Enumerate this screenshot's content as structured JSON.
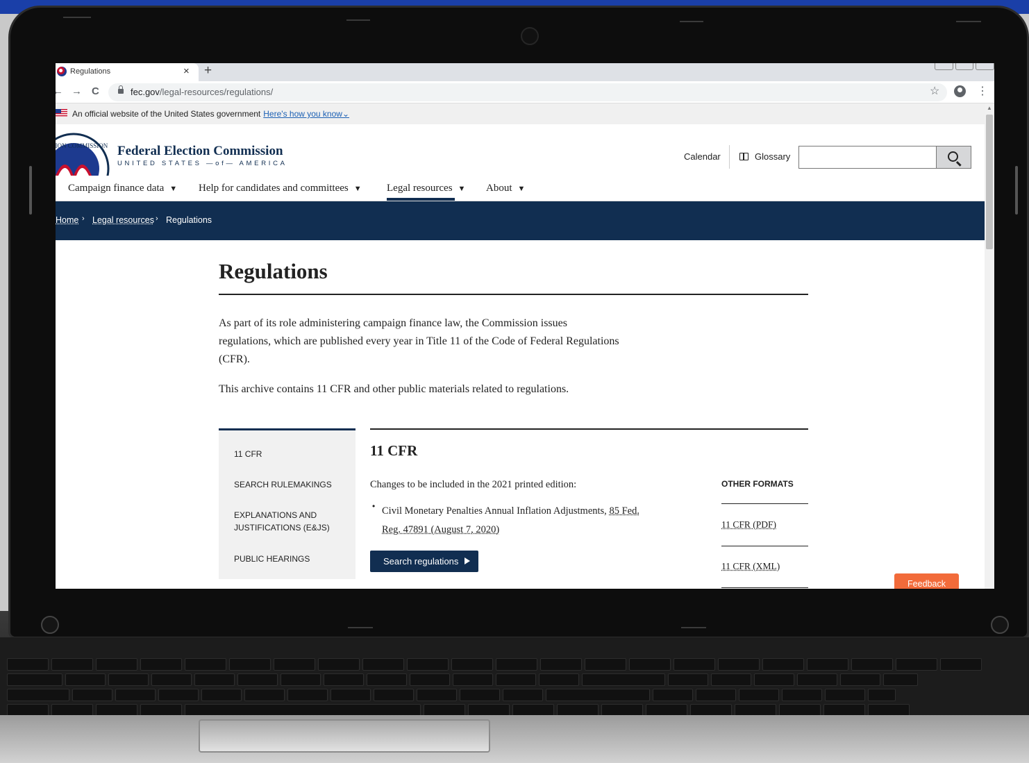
{
  "browser": {
    "tab_title": "Regulations",
    "tab_close": "×",
    "new_tab": "+",
    "back": "←",
    "forward": "→",
    "reload": "C",
    "url_host": "fec.gov",
    "url_path": "/legal-resources/regulations/",
    "bookmark": "☆",
    "menu": "⋮"
  },
  "gov_banner": {
    "text": "An official website of the United States government",
    "link": "Here's how you know",
    "chevron": "⌄"
  },
  "header": {
    "org_name": "Federal Election Commission",
    "org_sub": "UNITED STATES —of— AMERICA",
    "calendar": "Calendar",
    "glossary": "Glossary",
    "search_placeholder": ""
  },
  "nav": {
    "items": [
      {
        "label": "Campaign finance data",
        "caret": "▼"
      },
      {
        "label": "Help for candidates and committees",
        "caret": "▼"
      },
      {
        "label": "Legal resources",
        "caret": "▼"
      },
      {
        "label": "About",
        "caret": "▼"
      }
    ]
  },
  "breadcrumb": {
    "items": [
      "Home",
      "Legal resources",
      "Regulations"
    ],
    "sep": "›"
  },
  "page": {
    "title": "Regulations",
    "intro": "As part of its role administering campaign finance law, the Commission issues regulations, which are published every year in Title 11 of the Code of Federal Regulations (CFR).",
    "archive": "This archive contains 11 CFR and other public materials related to regulations."
  },
  "sidenav": {
    "items": [
      "11 CFR",
      "SEARCH RULEMAKINGS",
      "EXPLANATIONS AND JUSTIFICATIONS (E&JS)",
      "PUBLIC HEARINGS"
    ]
  },
  "section": {
    "title": "11 CFR",
    "changes": "Changes to be included in the 2021 printed edition:",
    "bullet": "•",
    "bullet_text": "Civil Monetary Penalties Annual Inflation Adjustments,",
    "citation": "85 Fed. Reg. 47891 (August 7, 2020)",
    "button": "Search regulations"
  },
  "other_formats": {
    "heading": "OTHER FORMATS",
    "links": [
      "11 CFR (PDF)",
      "11 CFR (XML)"
    ]
  },
  "feedback": "Feedback",
  "colors": {
    "navy": "#112e51",
    "feedback_orange": "#f26b3a",
    "link_blue": "#1a5fb4"
  }
}
